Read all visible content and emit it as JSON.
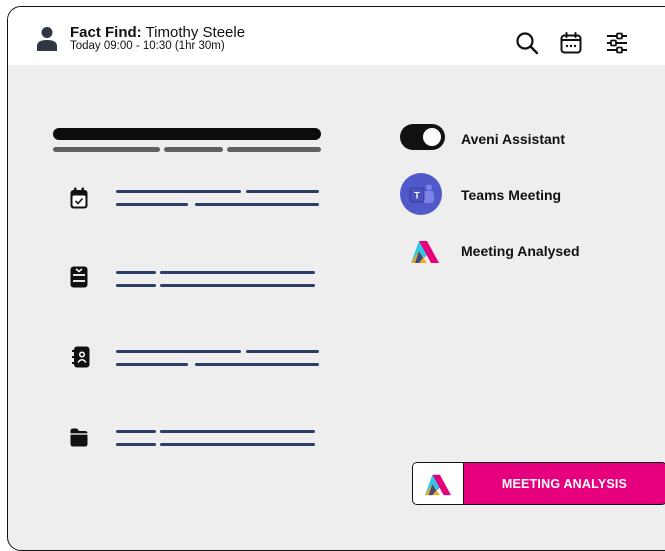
{
  "header": {
    "title_bold": "Fact Find:",
    "title_name": " Timothy Steele",
    "subtitle": "Today 09:00 - 10:30 (1hr 30m)",
    "icons": [
      "user-icon",
      "search-icon",
      "calendar-icon",
      "filter-sliders-icon"
    ]
  },
  "left_list": {
    "icons": [
      "calendar-check-icon",
      "inbox-icon",
      "contacts-book-icon",
      "folder-icon"
    ]
  },
  "right_panel": {
    "aveni_assistant": {
      "label": "Aveni Assistant",
      "toggle_on": true
    },
    "teams_meeting": {
      "label": "Teams Meeting",
      "icon": "teams-icon"
    },
    "meeting_analysed": {
      "label": "Meeting Analysed",
      "icon": "aveni-logo-icon"
    }
  },
  "action_button": {
    "label": "MEETING ANALYSIS"
  },
  "colors": {
    "accent": "#e6007e",
    "placeholder_lines": "#2e3d66",
    "teams": "#5059c9",
    "panel_bg": "#eeeeee"
  }
}
